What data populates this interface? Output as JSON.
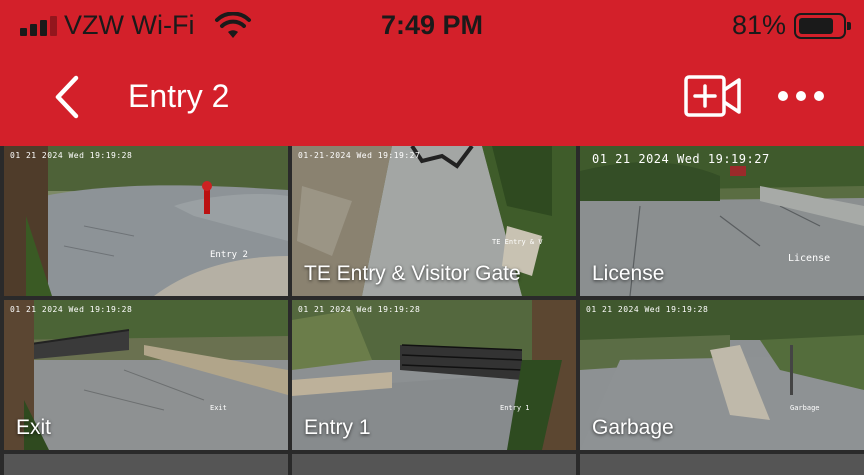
{
  "status_bar": {
    "carrier": "VZW Wi-Fi",
    "time": "7:49 PM",
    "battery_percent": "81%",
    "battery_level": 0.81
  },
  "nav": {
    "title": "Entry 2",
    "back_icon": "chevron-left-icon",
    "record_icon": "video-add-icon",
    "more_icon": "more-horizontal-icon"
  },
  "colors": {
    "accent": "#d3202a"
  },
  "cameras": [
    {
      "label": "",
      "timestamp": "01 21 2024 Wed 19:19:28",
      "overlay": "Entry 2",
      "selected": true
    },
    {
      "label": "TE Entry & Visitor Gate",
      "timestamp": "01-21-2024 Wed 19:19:27",
      "overlay": "TE Entry & V",
      "selected": false
    },
    {
      "label": "License",
      "timestamp": "01 21 2024 Wed 19:19:27",
      "overlay": "License",
      "selected": false
    },
    {
      "label": "Exit",
      "timestamp": "01 21 2024 Wed 19:19:28",
      "overlay": "Exit",
      "selected": false
    },
    {
      "label": "Entry 1",
      "timestamp": "01 21 2024 Wed 19:19:28",
      "overlay": "Entry 1",
      "selected": false
    },
    {
      "label": "Garbage",
      "timestamp": "01 21 2024 Wed 19:19:28",
      "overlay": "Garbage",
      "selected": false
    }
  ]
}
